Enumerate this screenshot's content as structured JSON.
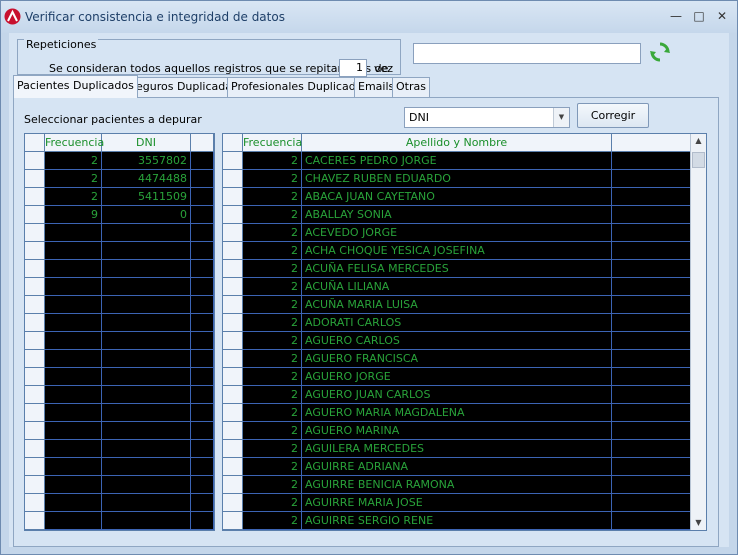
{
  "window": {
    "title": "Verificar consistencia e integridad de datos"
  },
  "repeticiones": {
    "legend": "Repeticiones",
    "text": "Se consideran todos aquellos registros que se repitan mas de",
    "value": "1",
    "unit": "vez"
  },
  "search": {
    "value": ""
  },
  "tabs": [
    {
      "label": "Pacientes Duplicados"
    },
    {
      "label": "Seguros Duplicadas"
    },
    {
      "label": "Profesionales Duplicados"
    },
    {
      "label": "Emails"
    },
    {
      "label": "Otras"
    }
  ],
  "panel": {
    "select_label": "Seleccionar pacientes a depurar",
    "combo_value": "DNI",
    "button_label": "Corregir"
  },
  "left_grid": {
    "headers": [
      "Frecuencia",
      "DNI"
    ],
    "rows": [
      [
        "2",
        "3557802"
      ],
      [
        "2",
        "4474488"
      ],
      [
        "2",
        "5411509"
      ],
      [
        "9",
        "0"
      ]
    ]
  },
  "right_grid": {
    "headers": [
      "Frecuencia",
      "Apellido y Nombre"
    ],
    "rows": [
      [
        "2",
        " CACERES PEDRO JORGE"
      ],
      [
        "2",
        " CHAVEZ RUBEN EDUARDO"
      ],
      [
        "2",
        "ABACA JUAN CAYETANO"
      ],
      [
        "2",
        "ABALLAY SONIA"
      ],
      [
        "2",
        "ACEVEDO JORGE"
      ],
      [
        "2",
        "ACHA CHOQUE YESICA JOSEFINA"
      ],
      [
        "2",
        "ACUÑA FELISA MERCEDES"
      ],
      [
        "2",
        "ACUÑA LILIANA"
      ],
      [
        "2",
        "ACUÑA MARIA LUISA"
      ],
      [
        "2",
        "ADORATI CARLOS"
      ],
      [
        "2",
        "AGUERO CARLOS"
      ],
      [
        "2",
        "AGUERO FRANCISCA"
      ],
      [
        "2",
        "AGUERO JORGE"
      ],
      [
        "2",
        "AGUERO JUAN CARLOS"
      ],
      [
        "2",
        "AGUERO MARIA MAGDALENA"
      ],
      [
        "2",
        "AGUERO MARINA"
      ],
      [
        "2",
        "AGUILERA MERCEDES"
      ],
      [
        "2",
        "AGUIRRE ADRIANA"
      ],
      [
        "2",
        "AGUIRRE BENICIA RAMONA"
      ],
      [
        "2",
        "AGUIRRE MARIA JOSE"
      ],
      [
        "2",
        "AGUIRRE SERGIO RENE"
      ]
    ]
  },
  "colors": {
    "grid_text": "#29a33a",
    "grid_bg": "#000000",
    "grid_lines": "#3c64b4"
  },
  "icons": {
    "app": "app-logo-icon",
    "refresh": "refresh-icon"
  }
}
